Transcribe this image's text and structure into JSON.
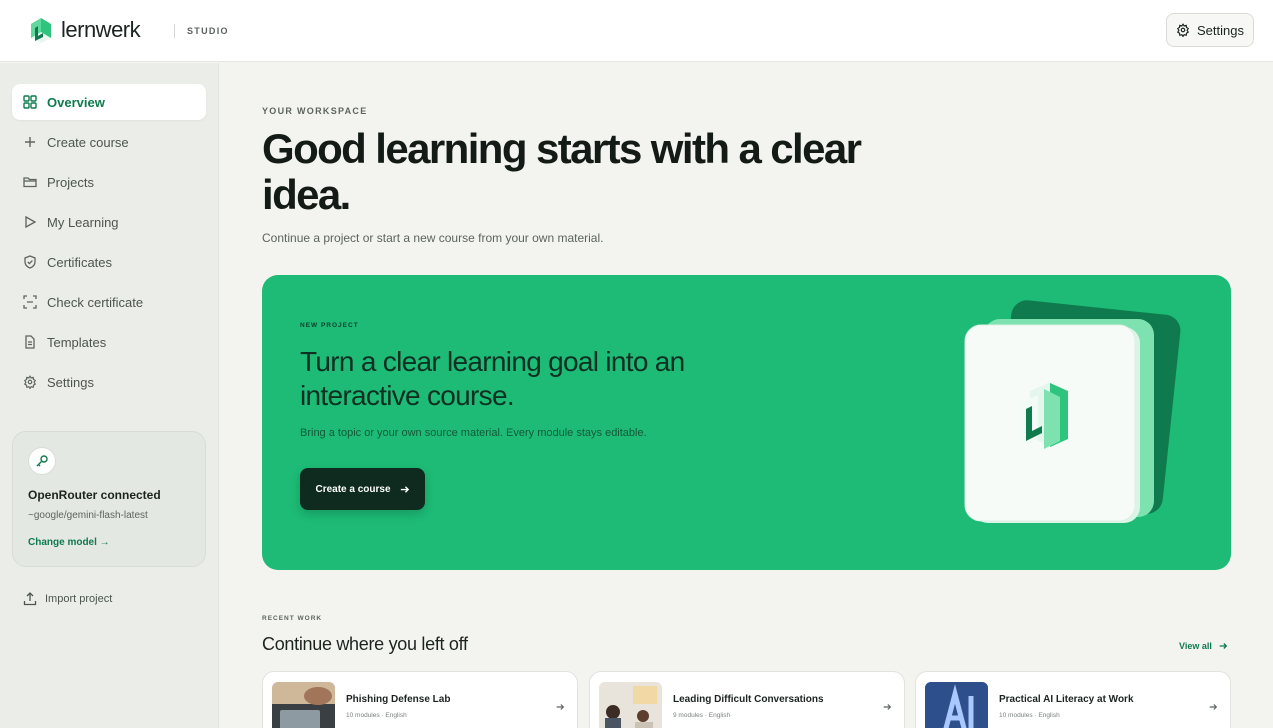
{
  "header": {
    "logo_text": "lernwerk",
    "studio_label": "STUDIO",
    "settings_label": "Settings"
  },
  "sidebar": {
    "items": [
      {
        "label": "Overview",
        "icon": "grid-icon",
        "active": true
      },
      {
        "label": "Create course",
        "icon": "plus-icon"
      },
      {
        "label": "Projects",
        "icon": "folder-icon"
      },
      {
        "label": "My Learning",
        "icon": "play-icon"
      },
      {
        "label": "Certificates",
        "icon": "shield-check-icon"
      },
      {
        "label": "Check certificate",
        "icon": "scan-icon"
      },
      {
        "label": "Templates",
        "icon": "document-icon"
      },
      {
        "label": "Settings",
        "icon": "gear-icon"
      }
    ],
    "provider": {
      "title": "OpenRouter connected",
      "model": "~google/gemini-flash-latest",
      "change_label": "Change model →"
    },
    "import_label": "Import project"
  },
  "main": {
    "eyebrow": "YOUR WORKSPACE",
    "headline": "Good learning starts with a clear idea.",
    "subline": "Continue a project or start a new course from your own material.",
    "hero": {
      "eyebrow": "NEW PROJECT",
      "title": "Turn a clear learning goal into an interactive course.",
      "subtitle": "Bring a topic or your own source material. Every module stays editable.",
      "button_label": "Create a course"
    },
    "recent": {
      "eyebrow": "RECENT WORK",
      "title": "Continue where you left off",
      "view_all_label": "View all",
      "projects": [
        {
          "title": "Phishing Defense Lab",
          "meta": "10 modules · English"
        },
        {
          "title": "Leading Difficult Conversations",
          "meta": "9 modules · English"
        },
        {
          "title": "Practical AI Literacy at Work",
          "meta": "10 modules · English"
        }
      ]
    }
  },
  "colors": {
    "brand_green": "#1dbb76",
    "accent_text": "#0f7a4d",
    "dark_button": "#0f2b1f"
  }
}
